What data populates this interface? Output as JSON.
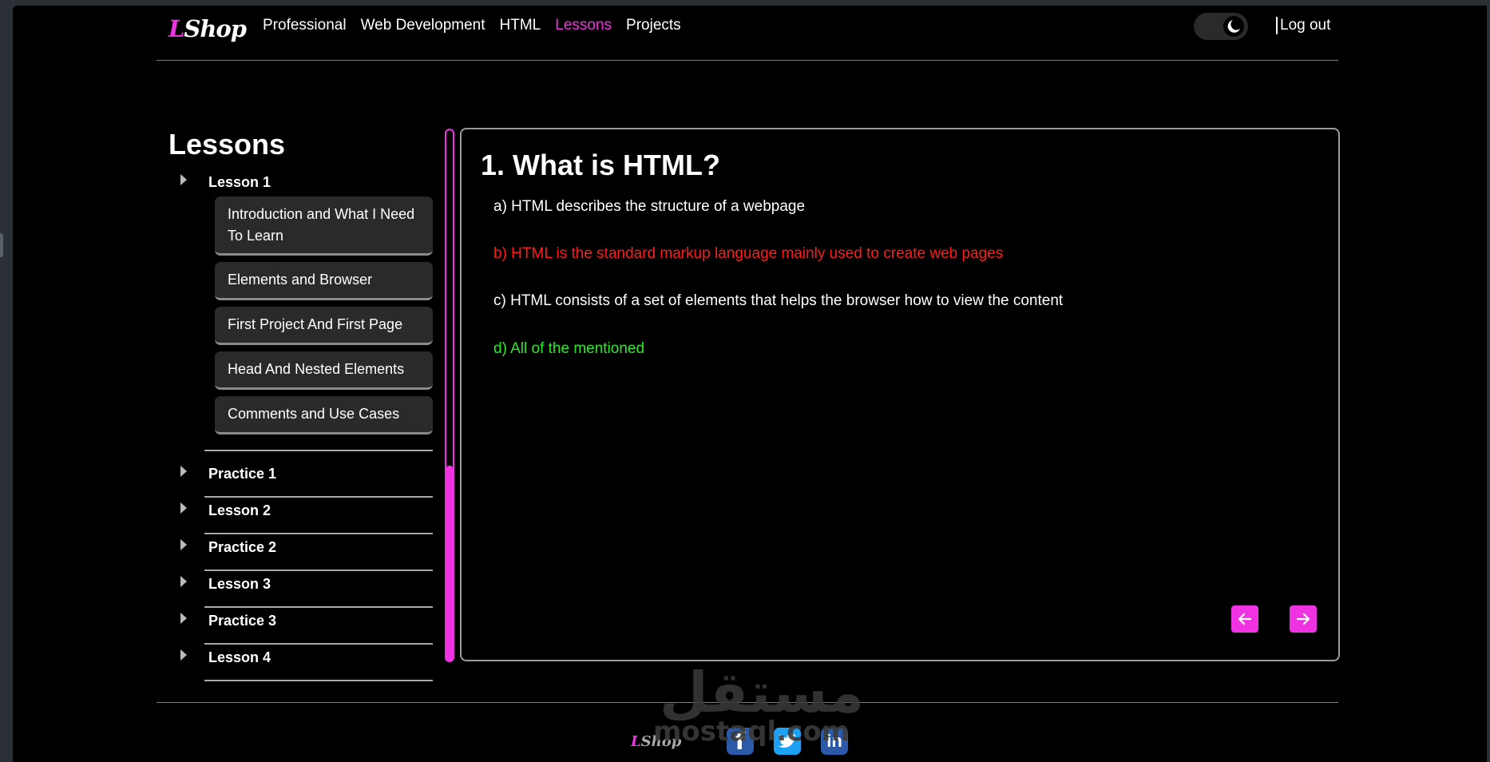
{
  "header": {
    "logo_letter": "L",
    "logo_text": "Shop",
    "nav": [
      "Professional",
      "Web Development",
      "HTML",
      "Lessons",
      "Projects"
    ],
    "active_nav": "Lessons",
    "logout": "Log out"
  },
  "sidebar": {
    "title": "Lessons",
    "expanded": {
      "label": "Lesson 1",
      "items": [
        "Introduction and What I Need To Learn",
        "Elements and Browser",
        "First Project And First Page",
        "Head And Nested Elements",
        "Comments and Use Cases"
      ]
    },
    "collapsed": [
      "Practice 1",
      "Lesson 2",
      "Practice 2",
      "Lesson 3",
      "Practice 3",
      "Lesson 4"
    ]
  },
  "question": {
    "title": "1. What is HTML?",
    "answers": [
      "a) HTML describes the structure of a webpage",
      "b) HTML is the standard markup language mainly used to create web pages",
      "c) HTML consists of a set of elements that helps the browser how to view the content",
      "d) All of the mentioned"
    ]
  },
  "watermark": {
    "arabic": "مستقل",
    "latin": "mostaql.com"
  },
  "footer": {
    "logo_letter": "L",
    "logo_text": "Shop",
    "facebook": "f",
    "linkedin": "in"
  },
  "colors": {
    "accent": "#f033e2",
    "wrong": "#ff1c1c",
    "correct": "#2ee62e"
  }
}
